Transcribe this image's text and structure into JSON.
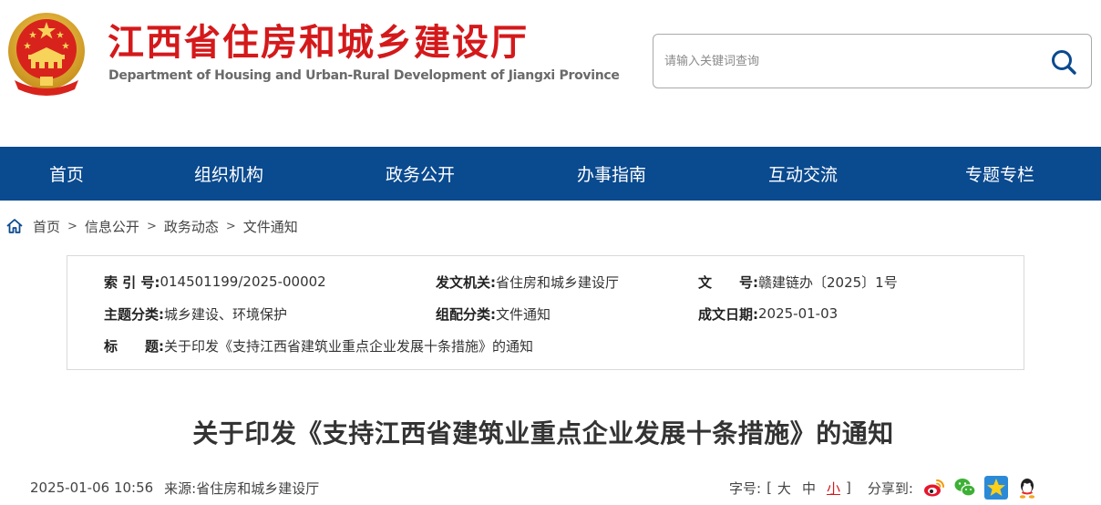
{
  "header": {
    "title": "江西省住房和城乡建设厅",
    "subtitle": "Department of Housing and Urban-Rural Development of Jiangxi Province",
    "search_placeholder": "请输入关键词查询"
  },
  "nav": {
    "items": [
      "首页",
      "组织机构",
      "政务公开",
      "办事指南",
      "互动交流",
      "专题专栏"
    ]
  },
  "breadcrumb": {
    "items": [
      "首页",
      "信息公开",
      "政务动态",
      "文件通知"
    ],
    "separator": ">"
  },
  "info": {
    "index_no_label": "索 引 号:",
    "index_no": "014501199/2025-00002",
    "issuer_label": "发文机关:",
    "issuer": "省住房和城乡建设厅",
    "doc_no_label": "文　　号:",
    "doc_no": "赣建链办〔2025〕1号",
    "topic_label": "主题分类:",
    "topic": "城乡建设、环境保护",
    "category_label": "组配分类:",
    "category": "文件通知",
    "date_label": "成文日期:",
    "date": "2025-01-03",
    "title_label": "标　　题:",
    "title": "关于印发《支持江西省建筑业重点企业发展十条措施》的通知"
  },
  "article": {
    "title": "关于印发《支持江西省建筑业重点企业发展十条措施》的通知",
    "publish_time": "2025-01-06 10:56",
    "source_label": "来源:",
    "source": "省住房和城乡建设厅"
  },
  "tools": {
    "font_size_label": "字号:",
    "bracket_open": "[",
    "bracket_close": "]",
    "font_large": "大",
    "font_medium": "中",
    "font_small": "小",
    "share_label": "分享到:"
  },
  "colors": {
    "brand_red": "#d4191b",
    "nav_blue": "#0a4a8f"
  }
}
